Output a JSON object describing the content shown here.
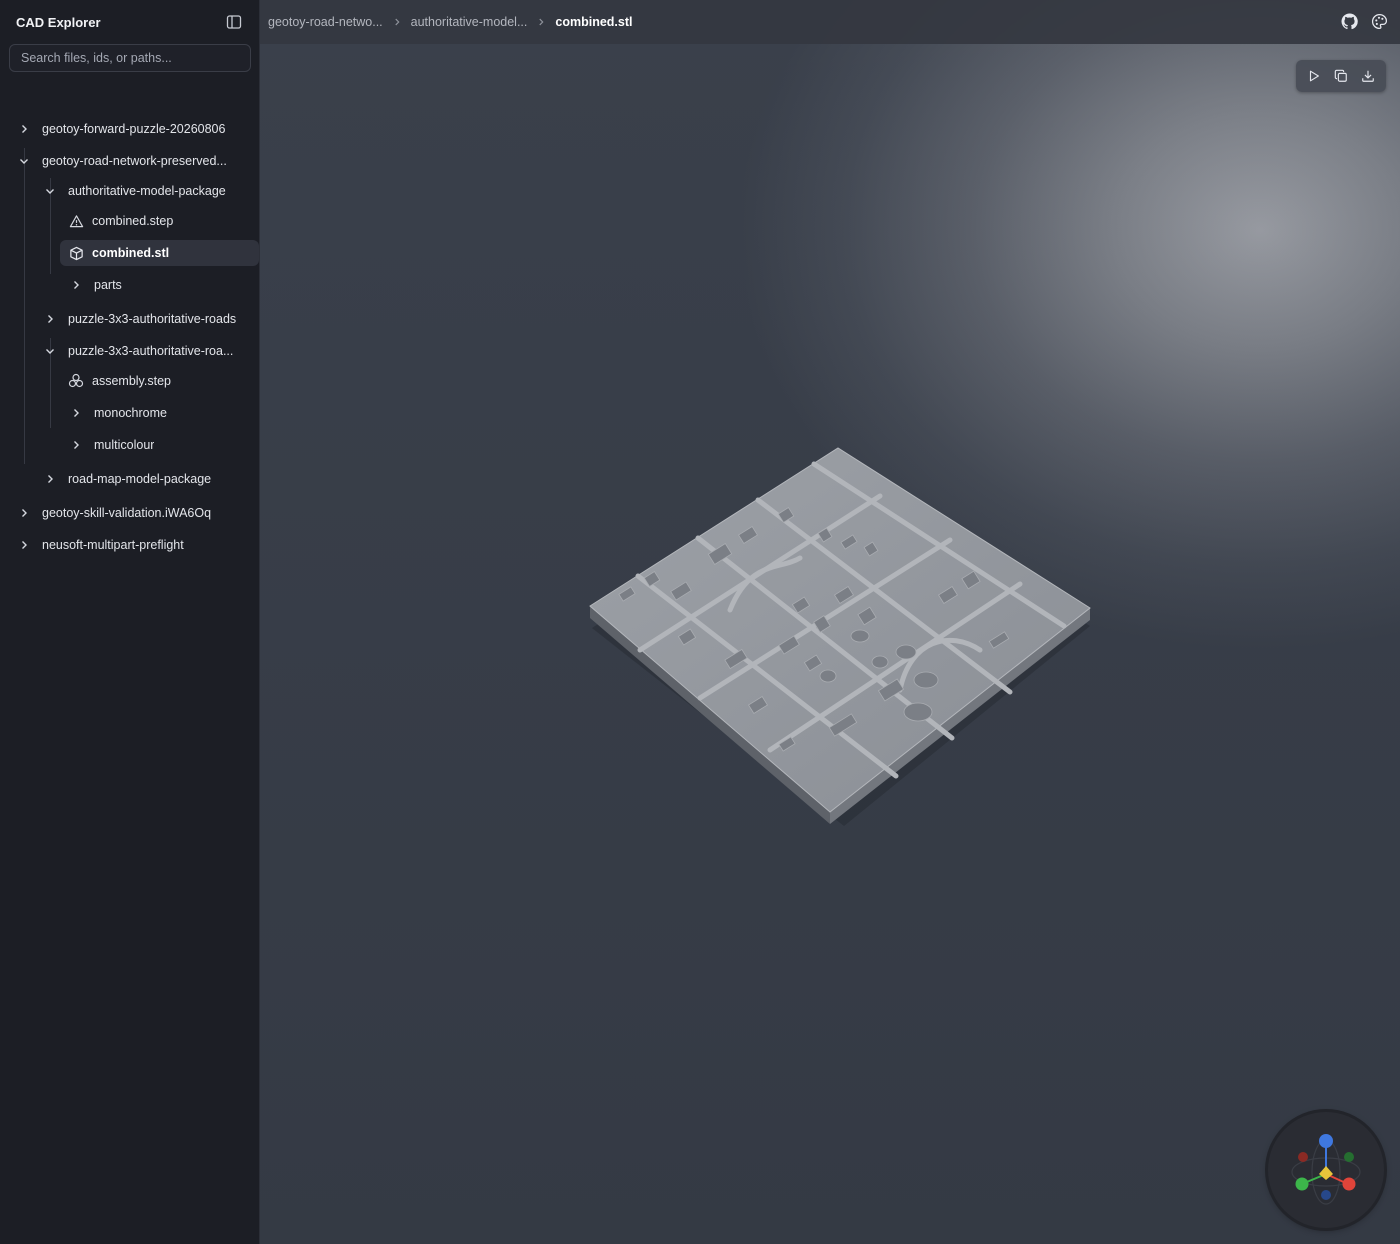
{
  "sidebar": {
    "title": "CAD Explorer",
    "search_placeholder": "Search files, ids, or paths...",
    "tree": [
      {
        "label": "geotoy-forward-puzzle-20260806",
        "icon": "chevron-right-icon"
      },
      {
        "label": "geotoy-road-network-preserved...",
        "icon": "chevron-down-icon"
      },
      {
        "label": "authoritative-model-package",
        "icon": "chevron-down-icon"
      },
      {
        "label": "combined.step",
        "icon": "warning-triangle-icon"
      },
      {
        "label": "combined.stl",
        "icon": "cube-icon",
        "selected": true
      },
      {
        "label": "parts",
        "icon": "chevron-right-icon"
      },
      {
        "label": "puzzle-3x3-authoritative-roads",
        "icon": "chevron-right-icon"
      },
      {
        "label": "puzzle-3x3-authoritative-roa...",
        "icon": "chevron-down-icon"
      },
      {
        "label": "assembly.step",
        "icon": "assembly-icon"
      },
      {
        "label": "monochrome",
        "icon": "chevron-right-icon"
      },
      {
        "label": "multicolour",
        "icon": "chevron-right-icon"
      },
      {
        "label": "road-map-model-package",
        "icon": "chevron-right-icon"
      },
      {
        "label": "geotoy-skill-validation.iWA6Oq",
        "icon": "chevron-right-icon"
      },
      {
        "label": "neusoft-multipart-preflight",
        "icon": "chevron-right-icon"
      }
    ]
  },
  "breadcrumb": [
    "geotoy-road-netwo...",
    "authoritative-model...",
    "combined.stl"
  ],
  "topbar_icons": [
    "github-icon",
    "palette-icon"
  ],
  "viewer_toolbar": [
    "play-icon",
    "copy-icon",
    "download-icon"
  ],
  "gizmo_colors": {
    "x": "#e0443a",
    "y": "#3cb54a",
    "z": "#3f78e0",
    "center": "#e8c53a"
  }
}
